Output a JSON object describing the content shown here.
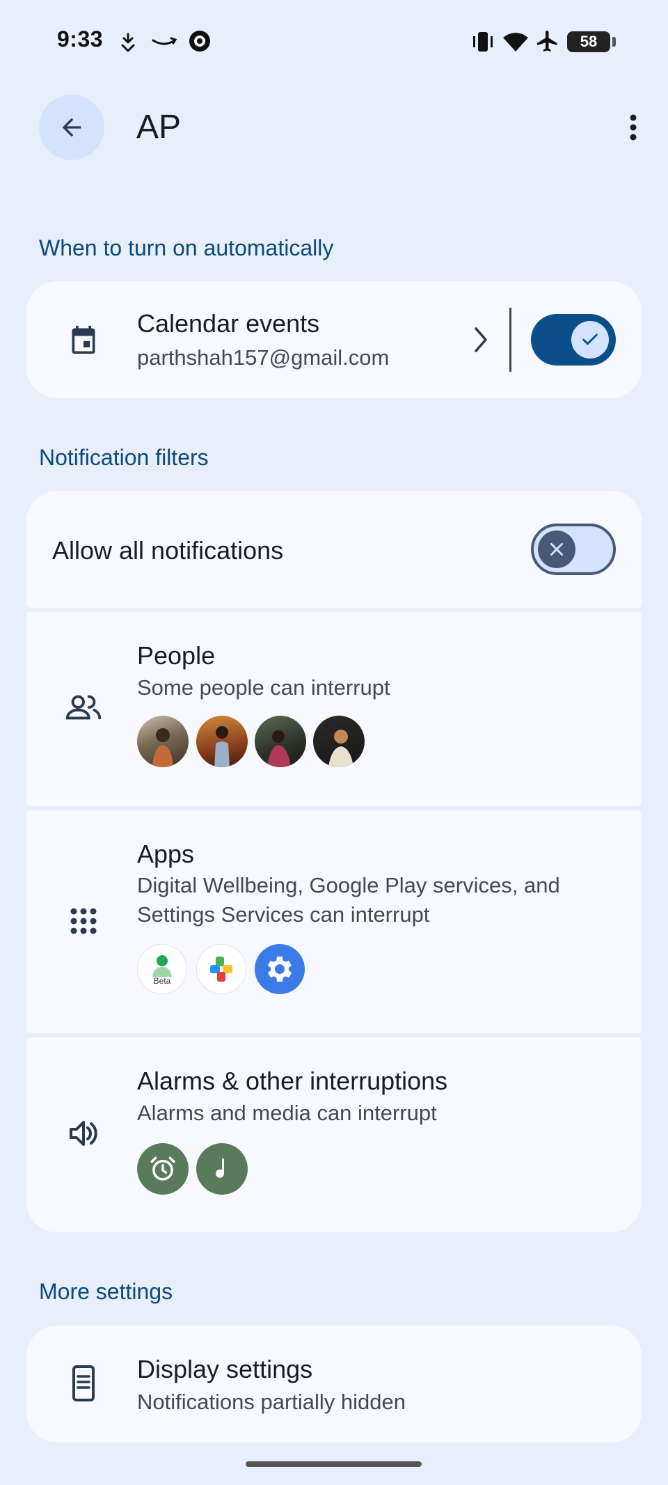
{
  "status_bar": {
    "time": "9:33",
    "battery": "58",
    "icons": [
      "hand-touch-icon",
      "amazon-smile-icon",
      "gear-blob-icon",
      "vibrate-icon",
      "wifi-icon",
      "airplane-icon",
      "battery-icon"
    ]
  },
  "header": {
    "title": "AP",
    "back_icon": "arrow-left-icon",
    "more_icon": "more-vert-icon"
  },
  "sections": {
    "auto": "When to turn on automatically",
    "filters": "Notification filters",
    "more": "More settings"
  },
  "calendar": {
    "title": "Calendar events",
    "subtitle": "parthshah157@gmail.com",
    "icon": "calendar-icon",
    "toggle_on": true
  },
  "allow_all": {
    "title": "Allow all notifications",
    "toggle_on": false
  },
  "people": {
    "title": "People",
    "subtitle": "Some people can interrupt",
    "icon": "people-icon"
  },
  "apps": {
    "title": "Apps",
    "subtitle": "Digital Wellbeing, Google Play services, and Settings Services can interrupt",
    "icon": "apps-grid-icon",
    "beta_label": "Beta"
  },
  "alarms": {
    "title": "Alarms & other interruptions",
    "subtitle": "Alarms and media can interrupt",
    "icon": "volume-icon"
  },
  "display": {
    "title": "Display settings",
    "subtitle": "Notifications partially hidden",
    "icon": "phone-display-icon"
  },
  "colors": {
    "background": "#e9eefb",
    "card": "#f8f9ff",
    "accent": "#0a4f8c",
    "section_label": "#0b4a7a",
    "toggle_off": "#d3e3fd"
  }
}
